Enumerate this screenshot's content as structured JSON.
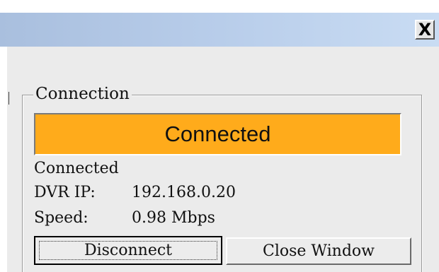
{
  "window": {
    "close_glyph": "X"
  },
  "connection": {
    "group_label": "Connection",
    "status_banner": "Connected",
    "status_text": "Connected",
    "dvr_ip_label": "DVR IP:",
    "dvr_ip_value": "192.168.0.20",
    "speed_label": "Speed:",
    "speed_value": "0.98 Mbps",
    "banner_color": "#ffab1b"
  },
  "buttons": {
    "disconnect_label": "Disconnect",
    "close_window_label": "Close Window"
  }
}
